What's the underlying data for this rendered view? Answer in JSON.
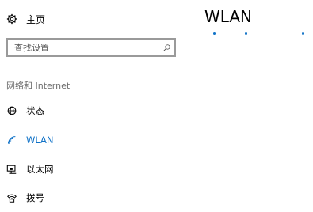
{
  "home": {
    "label": "主页",
    "icon": "gear-icon"
  },
  "search": {
    "placeholder": "查找设置",
    "icon": "search-icon"
  },
  "section_label": "网络和 Internet",
  "nav": {
    "items": [
      {
        "label": "状态",
        "icon": "globe-icon",
        "active": false
      },
      {
        "label": "WLAN",
        "icon": "wifi-icon",
        "active": true
      },
      {
        "label": "以太网",
        "icon": "ethernet-icon",
        "active": false
      },
      {
        "label": "拨号",
        "icon": "dialup-icon",
        "active": false
      }
    ]
  },
  "page": {
    "title": "WLAN"
  },
  "colors": {
    "accent": "#1072c7",
    "border": "#9a9a9a",
    "muted_text": "#6b6b6b"
  }
}
